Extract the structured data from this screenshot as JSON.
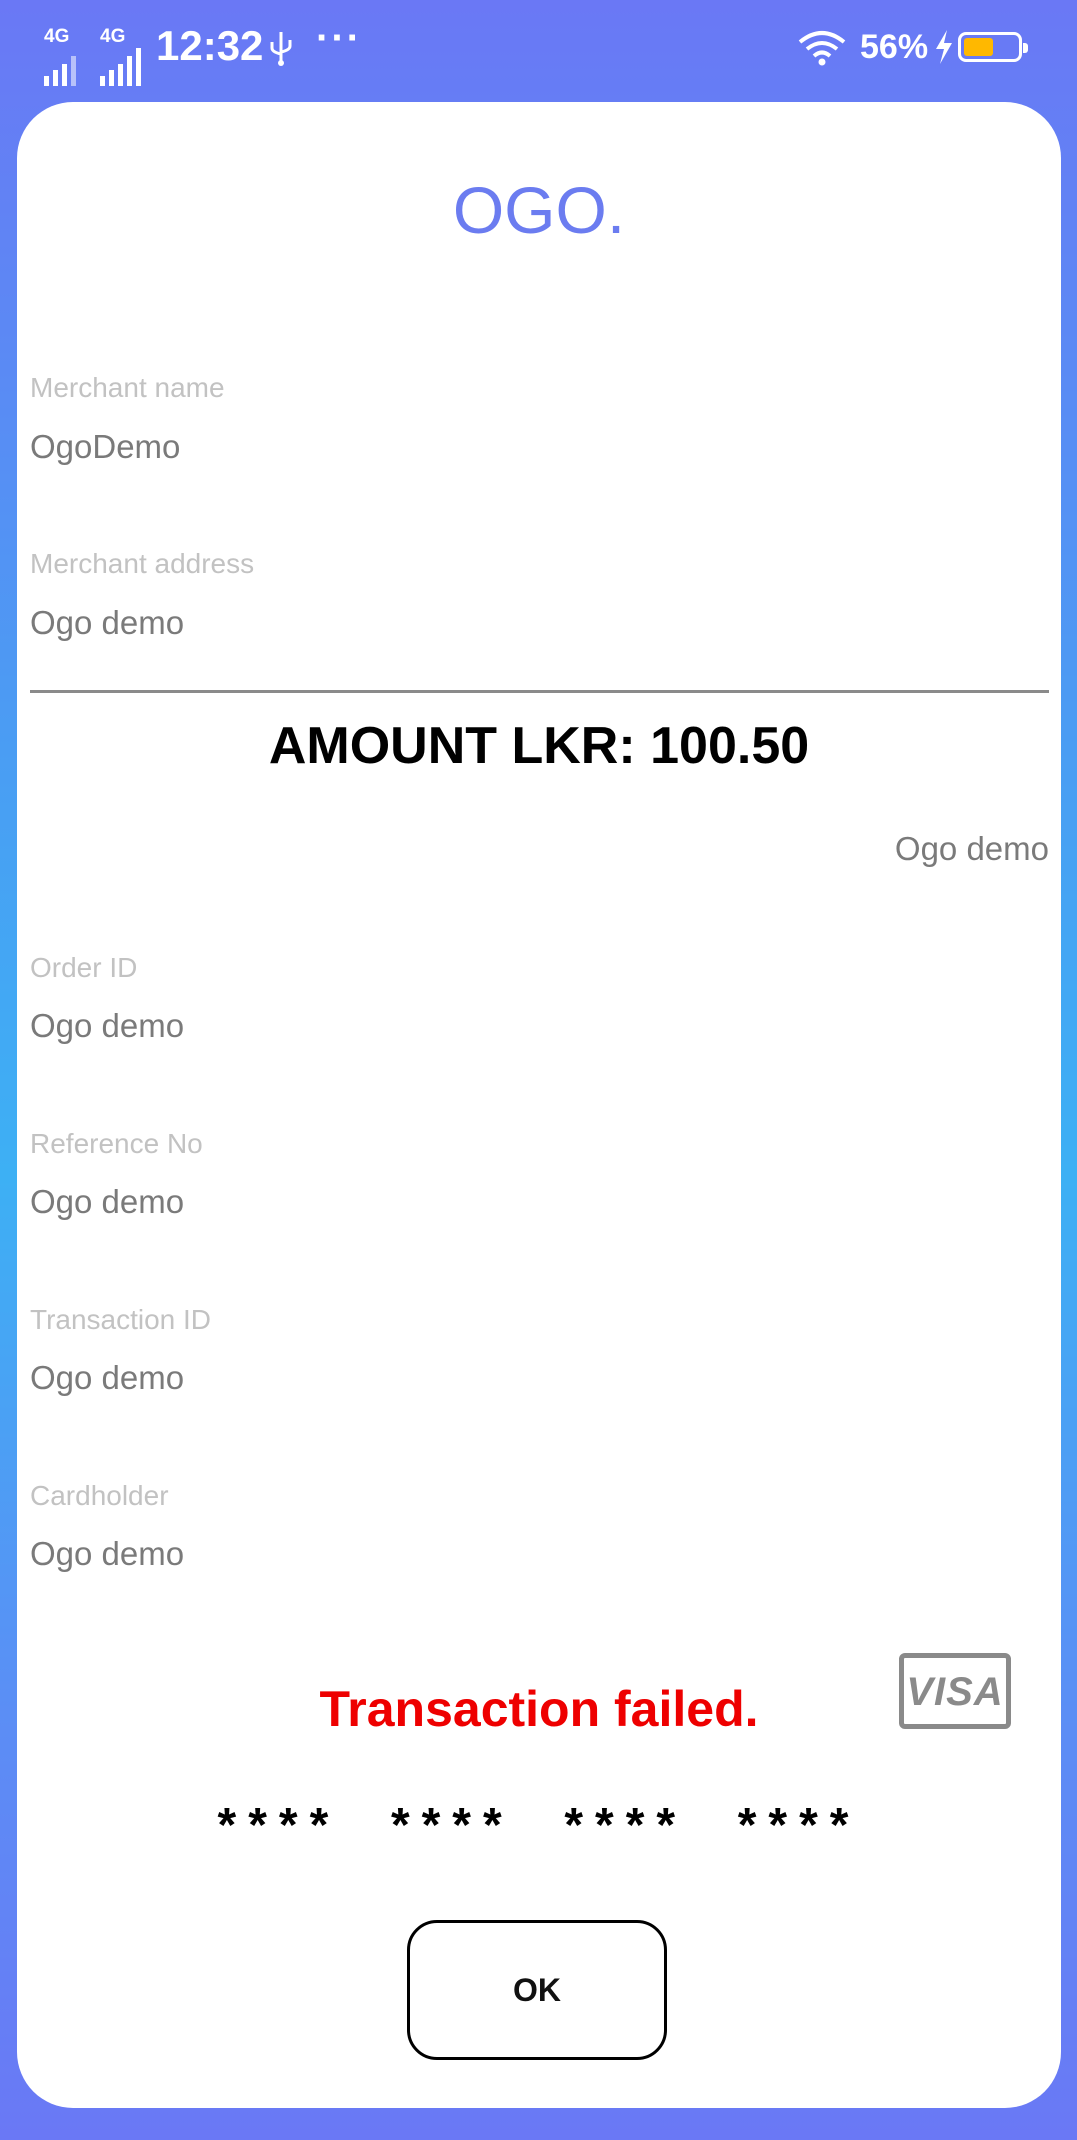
{
  "status_bar": {
    "network_1": "4G",
    "network_2": "4G",
    "time": "12:32",
    "more_indicator": "···",
    "battery_percent": "56%",
    "battery_level": 0.56,
    "battery_color": "#ffb800",
    "icons": [
      "signal-icon",
      "usb-icon",
      "wifi-icon",
      "charging-icon",
      "battery-icon"
    ]
  },
  "brand": {
    "logo_text": "OGO.",
    "color": "#6b7cf0"
  },
  "merchant": {
    "name_label": "Merchant name",
    "name_value": "OgoDemo",
    "address_label": "Merchant address",
    "address_value": "Ogo demo"
  },
  "amount": {
    "text": "AMOUNT LKR: 100.50"
  },
  "extra_value": "Ogo demo",
  "details": [
    {
      "label": "Order ID",
      "value": "Ogo demo"
    },
    {
      "label": "Reference No",
      "value": "Ogo demo"
    },
    {
      "label": "Transaction ID",
      "value": "Ogo demo"
    },
    {
      "label": "Cardholder",
      "value": "Ogo demo"
    }
  ],
  "card": {
    "brand": "VISA",
    "number_masked": "****  ****  ****  ****"
  },
  "result": {
    "message": "Transaction failed.",
    "color": "#ee0000"
  },
  "actions": {
    "ok_label": "OK"
  }
}
